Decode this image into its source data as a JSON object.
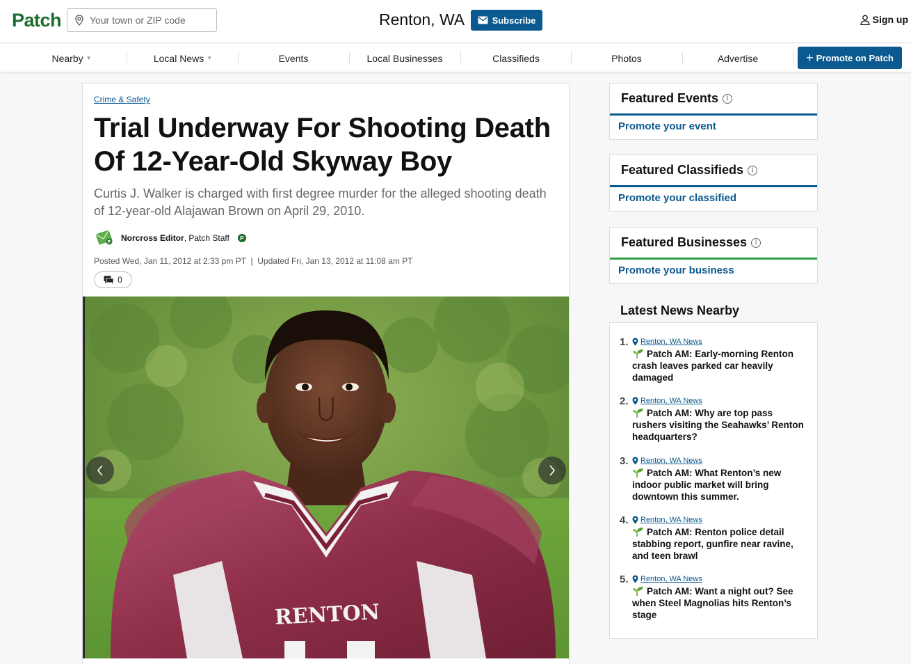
{
  "header": {
    "logo": "Patch",
    "search_placeholder": "Your town or ZIP code",
    "town": "Renton, WA",
    "subscribe_label": "Subscribe",
    "signup_label": "Sign up"
  },
  "nav": {
    "items": [
      {
        "label": "Nearby",
        "has_caret": true
      },
      {
        "label": "Local News",
        "has_caret": true
      },
      {
        "label": "Events"
      },
      {
        "label": "Local Businesses"
      },
      {
        "label": "Classifieds"
      },
      {
        "label": "Photos"
      },
      {
        "label": "Advertise"
      }
    ],
    "promote_label": "Promote on Patch"
  },
  "article": {
    "category": "Crime & Safety",
    "headline": "Trial Underway For Shooting Death Of 12-Year-Old Skyway Boy",
    "dek": "Curtis J. Walker is charged with first degree murder for the alleged shooting death of 12-year-old Alajawan Brown on April 29, 2010.",
    "author_name": "Norcross Editor",
    "author_role": ", Patch Staff",
    "author_badge": "P",
    "dates": "Posted Wed, Jan 11, 2012 at 2:33 pm PT  |  Updated Fri, Jan 13, 2012 at 11:08 am PT",
    "comment_count": "0",
    "jersey_text": "RENTON"
  },
  "sidebar": {
    "cards": [
      {
        "title": "Featured Events",
        "link": "Promote your event",
        "rule_color": "#0b5a8f"
      },
      {
        "title": "Featured Classifieds",
        "link": "Promote your classified",
        "rule_color": "#0b5a8f"
      },
      {
        "title": "Featured Businesses",
        "link": "Promote your business",
        "rule_color": "#2e9e3e"
      }
    ],
    "info_glyph": "i",
    "latest_title": "Latest News Nearby",
    "news": [
      {
        "num": "1.",
        "source": "Renton, WA News",
        "text": "Patch AM: Early-morning Renton crash leaves parked car heavily damaged"
      },
      {
        "num": "2.",
        "source": "Renton, WA News",
        "text": "Patch AM: Why are top pass rushers visiting the Seahawks’ Renton headquarters?"
      },
      {
        "num": "3.",
        "source": "Renton, WA News",
        "text": "Patch AM: What Renton’s new indoor public market will bring downtown this summer."
      },
      {
        "num": "4.",
        "source": "Renton, WA News",
        "text": "Patch AM: Renton police detail stabbing report, gunfire near ravine, and teen brawl"
      },
      {
        "num": "5.",
        "source": "Renton, WA News",
        "text": "Patch AM: Want a night out? See when Steel Magnolias hits Renton’s stage"
      }
    ]
  },
  "colors": {
    "brand_green": "#1b6e2e",
    "brand_blue": "#0b5a8f"
  }
}
